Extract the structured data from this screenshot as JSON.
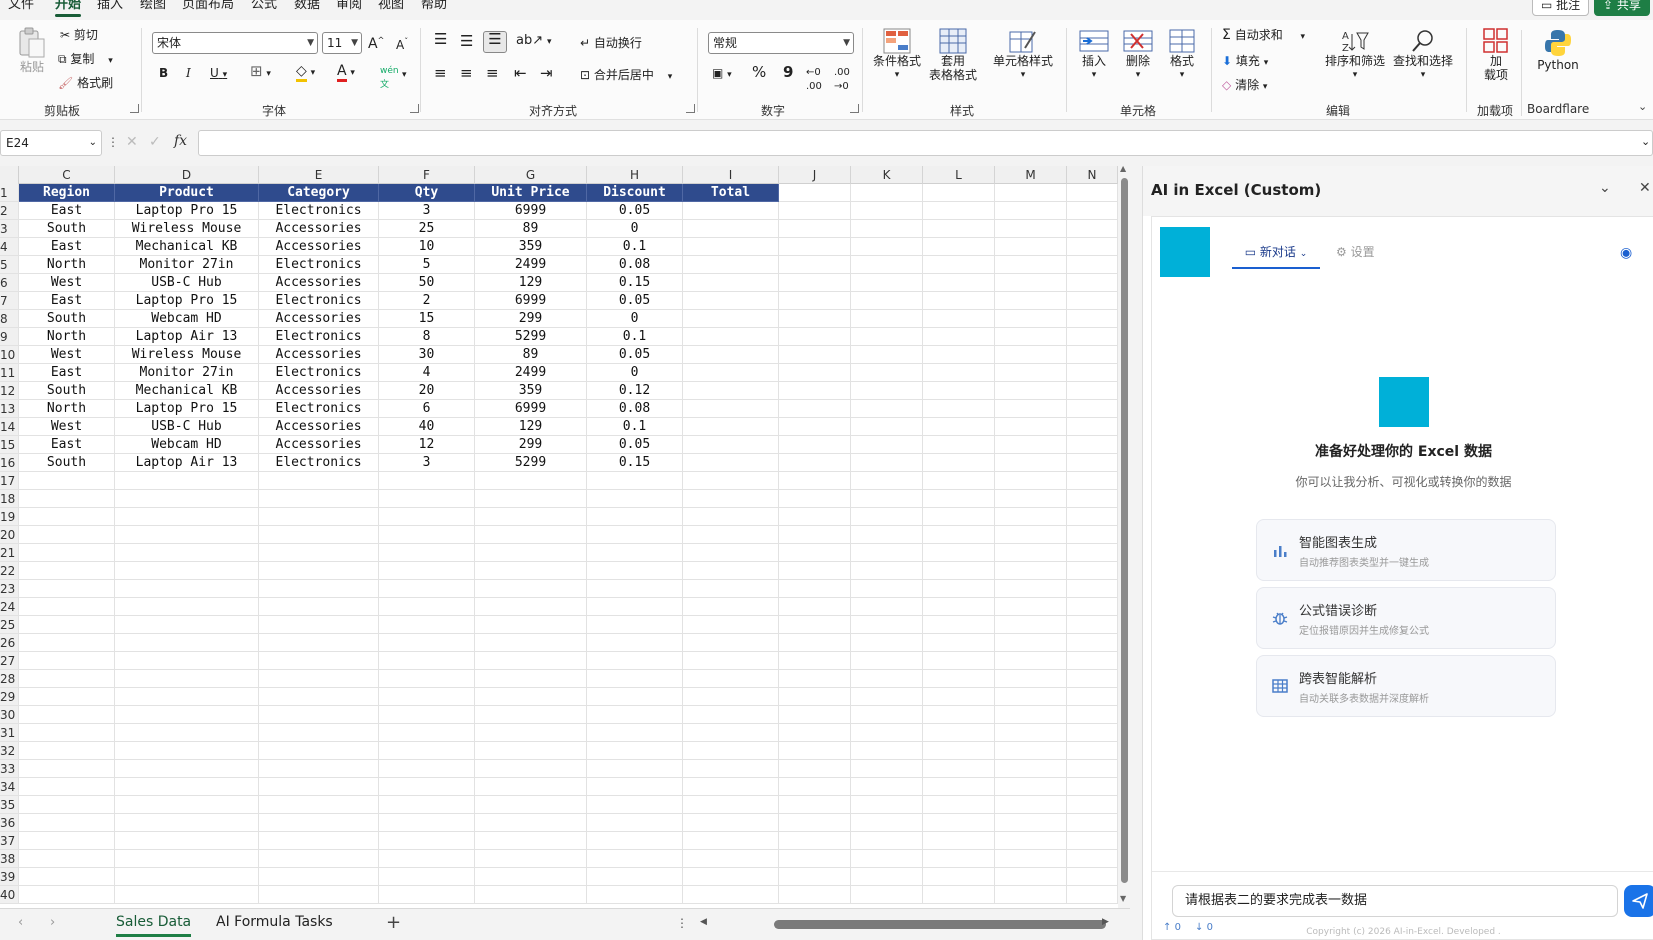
{
  "tabs": [
    "文件",
    "开始",
    "插入",
    "绘图",
    "页面布局",
    "公式",
    "数据",
    "审阅",
    "视图",
    "帮助"
  ],
  "top_buttons": {
    "comment": "批注",
    "share": "共享"
  },
  "ribbon": {
    "clipboard": {
      "label": "剪贴板",
      "paste": "粘贴",
      "cut": "剪切",
      "copy": "复制",
      "format_painter": "格式刷"
    },
    "font": {
      "label": "字体",
      "family": "宋体",
      "size": "11"
    },
    "alignment": {
      "label": "对齐方式",
      "wrap": "自动换行",
      "merge": "合并后居中"
    },
    "number": {
      "label": "数字",
      "format": "常规"
    },
    "styles": {
      "label": "样式",
      "conditional": "条件格式",
      "table_line1": "套用",
      "table_line2": "表格格式",
      "cell_styles": "单元格样式"
    },
    "cells": {
      "label": "单元格",
      "insert": "插入",
      "delete": "删除",
      "format": "格式"
    },
    "editing": {
      "label": "编辑",
      "autosum": "自动求和",
      "fill": "填充",
      "clear": "清除",
      "sort": "排序和筛选",
      "find": "查找和选择"
    },
    "addins": {
      "label": "加载项",
      "addin_line1": "加",
      "addin_line2": "载项",
      "python": "Python",
      "boardflare": "Boardflare"
    }
  },
  "formula_bar": {
    "name_box": "E24",
    "fx": "fx",
    "value": ""
  },
  "grid": {
    "columns": [
      "C",
      "D",
      "E",
      "F",
      "G",
      "H",
      "I",
      "J",
      "K",
      "L",
      "M",
      "N"
    ],
    "header": [
      "Region",
      "Product",
      "Category",
      "Qty",
      "Unit Price",
      "Discount",
      "Total"
    ],
    "rows": [
      [
        "East",
        "Laptop Pro 15",
        "Electronics",
        "3",
        "6999",
        "0.05"
      ],
      [
        "South",
        "Wireless Mouse",
        "Accessories",
        "25",
        "89",
        "0"
      ],
      [
        "East",
        "Mechanical KB",
        "Accessories",
        "10",
        "359",
        "0.1"
      ],
      [
        "North",
        "Monitor 27in",
        "Electronics",
        "5",
        "2499",
        "0.08"
      ],
      [
        "West",
        "USB-C Hub",
        "Accessories",
        "50",
        "129",
        "0.15"
      ],
      [
        "East",
        "Laptop Pro 15",
        "Electronics",
        "2",
        "6999",
        "0.05"
      ],
      [
        "South",
        "Webcam HD",
        "Accessories",
        "15",
        "299",
        "0"
      ],
      [
        "North",
        "Laptop Air 13",
        "Electronics",
        "8",
        "5299",
        "0.1"
      ],
      [
        "West",
        "Wireless Mouse",
        "Accessories",
        "30",
        "89",
        "0.05"
      ],
      [
        "East",
        "Monitor 27in",
        "Electronics",
        "4",
        "2499",
        "0"
      ],
      [
        "South",
        "Mechanical KB",
        "Accessories",
        "20",
        "359",
        "0.12"
      ],
      [
        "North",
        "Laptop Pro 15",
        "Electronics",
        "6",
        "6999",
        "0.08"
      ],
      [
        "West",
        "USB-C Hub",
        "Accessories",
        "40",
        "129",
        "0.1"
      ],
      [
        "East",
        "Webcam HD",
        "Accessories",
        "12",
        "299",
        "0.05"
      ],
      [
        "South",
        "Laptop Air 13",
        "Electronics",
        "3",
        "5299",
        "0.15"
      ]
    ],
    "row_numbers": [
      "1",
      "2",
      "3",
      "4",
      "5",
      "6",
      "7",
      "8",
      "9",
      "10",
      "11",
      "12",
      "13",
      "14",
      "15",
      "16",
      "17",
      "18",
      "19",
      "20",
      "21",
      "22",
      "23",
      "24",
      "25",
      "26",
      "27",
      "28",
      "29",
      "30",
      "31",
      "32",
      "33",
      "34",
      "35",
      "36",
      "37",
      "38",
      "39",
      "40"
    ]
  },
  "sheets": [
    "Sales Data",
    "AI Formula Tasks"
  ],
  "panel": {
    "title": "AI in Excel (Custom)",
    "tab_new": "新对话",
    "tab_settings": "设置",
    "ready_title": "准备好处理你的 Excel 数据",
    "ready_sub": "你可以让我分析、可视化或转换你的数据",
    "cards": [
      {
        "title": "智能图表生成",
        "sub": "自动推荐图表类型并一键生成"
      },
      {
        "title": "公式错误诊断",
        "sub": "定位报错原因并生成修复公式"
      },
      {
        "title": "跨表智能解析",
        "sub": "自动关联多表数据并深度解析"
      }
    ],
    "input_value": "请根据表二的要求完成表一数据",
    "copyright": "Copyright (c) 2026 AI-in-Excel. Developed .",
    "up_count": "0",
    "down_count": "0"
  },
  "colors": {
    "accent": "#185c37",
    "header_fill": "#2f4b8d",
    "brand_square": "#00b0d8",
    "send": "#1a73e8"
  }
}
